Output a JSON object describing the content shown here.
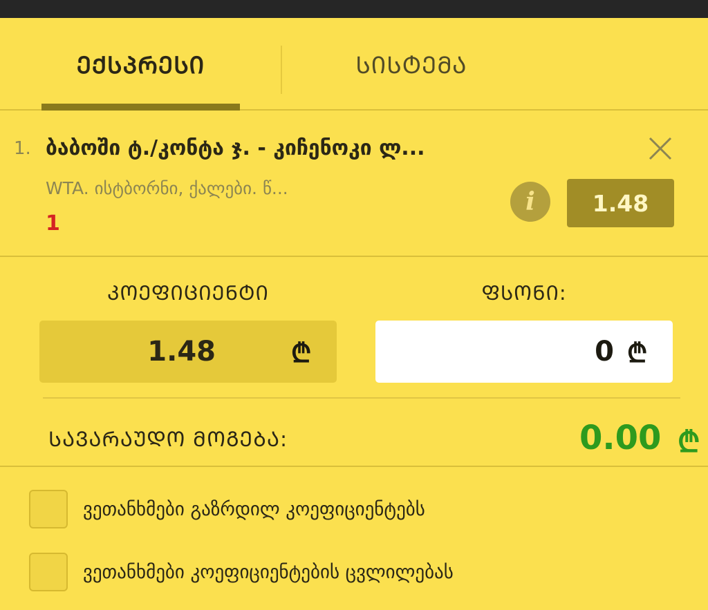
{
  "tabs": [
    {
      "label": "ᲔᲥᲡᲞᲠᲔᲡᲘ",
      "active": true
    },
    {
      "label": "ᲡᲘᲡᲢᲔᲛᲐ",
      "active": false
    }
  ],
  "bet": {
    "number": "1.",
    "title": "ბაბოში ტ./კონტა ჯ. - კიჩენოკი ლ...",
    "league": "WTA. ისტბორნი, ქალები. წ...",
    "outcome": "1",
    "odds": "1.48",
    "icons": {
      "close": "close-icon",
      "info": "info-icon"
    }
  },
  "coefficient": {
    "label": "ᲙᲝᲔᲤᲘᲪᲘᲔᲜᲢᲘ",
    "value": "1.48",
    "currency": "₾"
  },
  "stake": {
    "label": "ᲤᲡᲝᲜᲘ:",
    "value": "0",
    "currency": "₾"
  },
  "potential_win": {
    "label": "ᲡᲐᲕᲐᲠᲐᲣᲓᲝ ᲛᲝᲒᲔᲑᲐ:",
    "value": "0.00",
    "currency": "₾"
  },
  "options": [
    {
      "label": "ვეთანხმები გაზრდილ კოეფიციენტებს",
      "checked": false
    },
    {
      "label": "ვეთანხმები კოეფიციენტების ცვლილებას",
      "checked": false
    }
  ],
  "colors": {
    "background": "#fbe04f",
    "accent": "#a18d26",
    "win_green": "#2e9a1e",
    "outcome_red": "#d42323"
  }
}
